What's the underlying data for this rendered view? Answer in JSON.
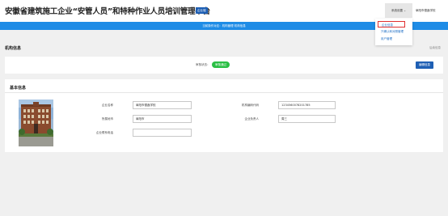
{
  "header": {
    "title": "安徽省建筑施工企业“安管人员”和特种作业人员培训管理平台",
    "badge": "企业端",
    "settings_label": "系统设置 ⌄",
    "school_name": "阜阳市德鑫学校"
  },
  "dropdown": {
    "items": [
      {
        "label": "企业信息",
        "active": true
      },
      {
        "label": "只确认和对照管理",
        "active": false
      },
      {
        "label": "用户管理",
        "active": false
      }
    ]
  },
  "notice": "当前操作对应：机构管理 机构信息",
  "org_section": {
    "title": "机构信息",
    "back_label": "后续信息",
    "review_label": "审核状态：",
    "review_status": "审核通过",
    "edit_button": "编辑信息"
  },
  "basic_section": {
    "title": "基本信息",
    "fields": {
      "company_name": {
        "label": "企业名称",
        "value": "阜阳市德鑫学校"
      },
      "credit_code": {
        "label": "机构编码代码",
        "value": "1234560078201785"
      },
      "city": {
        "label": "所属地市",
        "value": "阜阳市"
      },
      "legal_person": {
        "label": "企业负责人",
        "value": "周三"
      },
      "contact": {
        "label": "企业联系电话",
        "value": ""
      }
    }
  },
  "colors": {
    "primary": "#1e5fb4",
    "notice_bar": "#1e8ce6",
    "success": "#2bbf45",
    "link": "#1f6fc6"
  }
}
